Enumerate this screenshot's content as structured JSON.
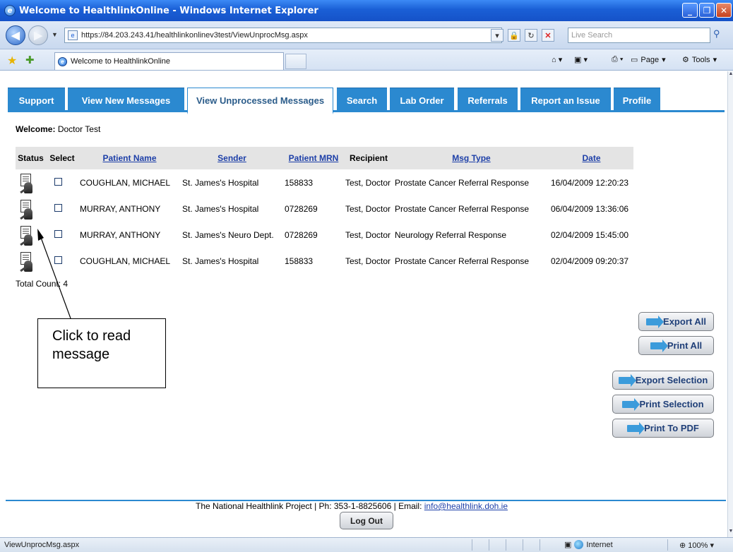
{
  "browser": {
    "window_title": "Welcome to HealthlinkOnline - Windows Internet Explorer",
    "url": "https://84.203.243.41/healthlinkonlinev3test/ViewUnprocMsg.aspx",
    "search_placeholder": "Live Search",
    "tab_title": "Welcome to HealthlinkOnline",
    "page_menu": "Page",
    "tools_menu": "Tools",
    "status_text": "ViewUnprocMsg.aspx",
    "zone": "Internet",
    "zoom": "100%"
  },
  "nav": {
    "tabs": [
      {
        "label": "Support"
      },
      {
        "label": "View New Messages"
      },
      {
        "label": "View Unprocessed Messages"
      },
      {
        "label": "Search"
      },
      {
        "label": "Lab Order"
      },
      {
        "label": "Referrals"
      },
      {
        "label": "Report an Issue"
      },
      {
        "label": "Profile"
      }
    ],
    "active_tab": "View Unprocessed Messages"
  },
  "welcome": {
    "label": "Welcome:",
    "user": "Doctor Test"
  },
  "table": {
    "columns": [
      "Status",
      "Select",
      "Patient Name",
      "Sender",
      "Patient MRN",
      "Recipient",
      "Msg Type",
      "Date"
    ],
    "rows": [
      {
        "patient": "COUGHLAN, MICHAEL",
        "sender": "St. James's Hospital",
        "mrn": "158833",
        "recipient": "Test, Doctor",
        "type": "Prostate Cancer Referral Response",
        "date": "16/04/2009 12:20:23"
      },
      {
        "patient": "MURRAY, ANTHONY",
        "sender": "St. James's Hospital",
        "mrn": "0728269",
        "recipient": "Test, Doctor",
        "type": "Prostate Cancer Referral Response",
        "date": "06/04/2009 13:36:06"
      },
      {
        "patient": "MURRAY, ANTHONY",
        "sender": "St. James's Neuro Dept.",
        "mrn": "0728269",
        "recipient": "Test, Doctor",
        "type": "Neurology Referral Response",
        "date": "02/04/2009 15:45:00"
      },
      {
        "patient": "COUGHLAN, MICHAEL",
        "sender": "St. James's Hospital",
        "mrn": "158833",
        "recipient": "Test, Doctor",
        "type": "Prostate Cancer Referral Response",
        "date": "02/04/2009 09:20:37"
      }
    ],
    "total_count": "Total Count: 4"
  },
  "actions": {
    "export_all": "Export All",
    "print_all": "Print All",
    "export_selection": "Export Selection",
    "print_selection": "Print Selection",
    "print_pdf": "Print To PDF"
  },
  "callout": {
    "text": "Click to read message"
  },
  "footer": {
    "text": "The National Healthlink Project | Ph: 353-1-8825606 | Email:",
    "email": "info@healthlink.doh.ie",
    "logout": "Log Out"
  },
  "colors": {
    "tab_blue": "#2b89d0",
    "link_blue": "#1d3fa8"
  }
}
